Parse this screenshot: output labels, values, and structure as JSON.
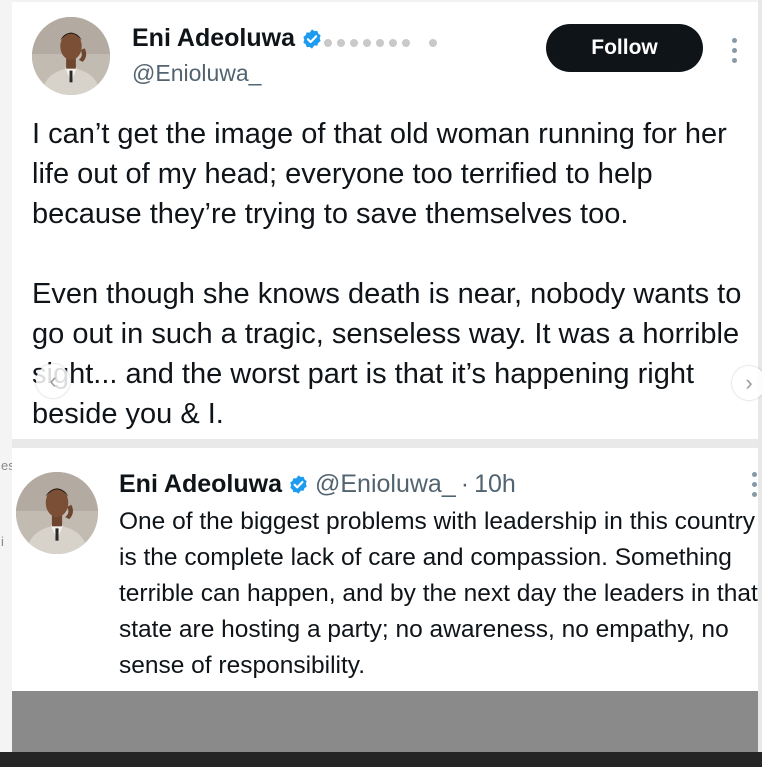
{
  "post": {
    "author": {
      "name": "Eni Adeoluwa",
      "handle": "@Enioluwa_",
      "verified": true
    },
    "follow_label": "Follow",
    "paragraphs": [
      "I can’t get the image of that old woman running for her life out of my head; everyone too terrified to help because they’re trying to save themselves too.",
      "Even though she knows death is near, nobody wants to go out in such a tragic, senseless way. It was a horrible sight... and the worst part is that it’s happening right beside you & I."
    ]
  },
  "quoted": {
    "author": {
      "name": "Eni Adeoluwa",
      "handle": "@Enioluwa_",
      "verified": true
    },
    "separator": "·",
    "time": "10h",
    "text": "One of the biggest problems with leadership in this country is the complete lack of care and compassion. Something terrible can happen, and by the next day the leaders in that state are hosting a party; no awareness, no empathy, no sense of responsibility."
  },
  "carousel": {
    "dot_count": 9,
    "active_index": 7,
    "prev_icon": "chevron-left-icon",
    "next_icon": "chevron-right-icon"
  },
  "background_edge_glyphs": [
    "es",
    "i"
  ],
  "colors": {
    "follow_button": "#0f1419",
    "verified_badge": "#1d9bf0",
    "secondary_text": "#536471",
    "carousel_bar": "#8a8a8a"
  }
}
